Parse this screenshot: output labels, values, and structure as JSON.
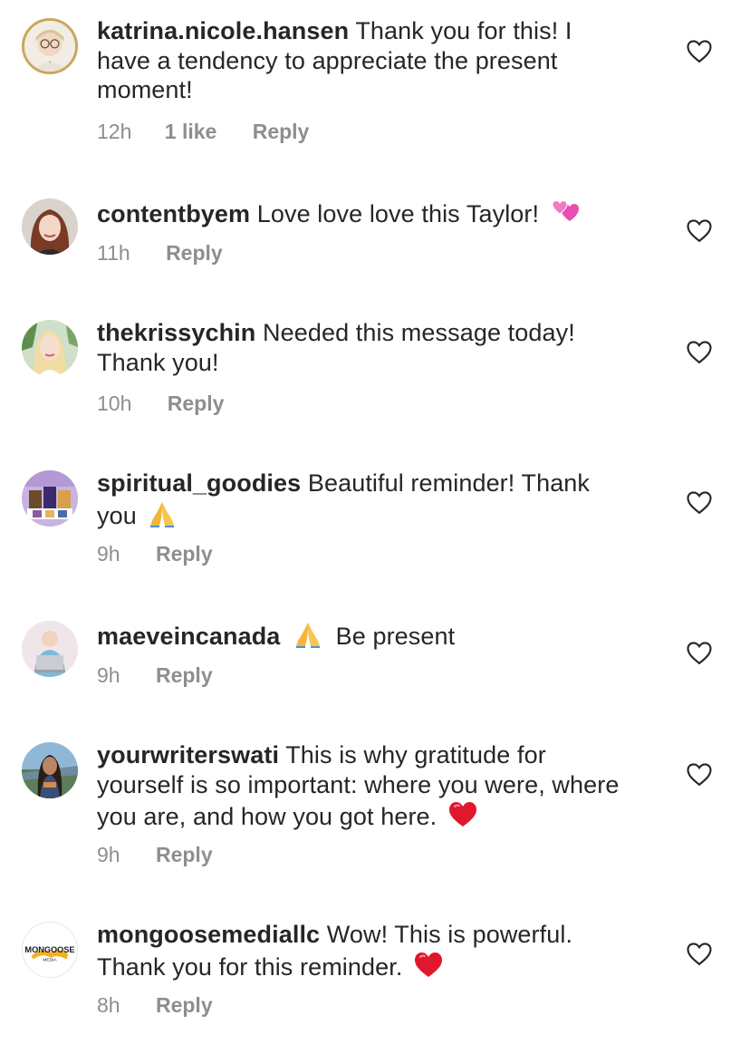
{
  "comments": [
    {
      "username": "katrina.nicole.hansen",
      "text": "Thank you for this! I have a tendency to appreciate the present moment!",
      "time": "12h",
      "likes": "1 like",
      "reply": "Reply",
      "avatar": "avatar-woman-glasses",
      "emoji": ""
    },
    {
      "username": "contentbyem",
      "text": "Love love love this Taylor!",
      "time": "11h",
      "likes": "",
      "reply": "Reply",
      "avatar": "avatar-woman-red-hair",
      "emoji": "two-hearts-emoji"
    },
    {
      "username": "thekrissychin",
      "text": "Needed this message today! Thank you!",
      "time": "10h",
      "likes": "",
      "reply": "Reply",
      "avatar": "avatar-woman-blonde",
      "emoji": ""
    },
    {
      "username": "spiritual_goodies",
      "text": "Beautiful reminder! Thank you",
      "time": "9h",
      "likes": "",
      "reply": "Reply",
      "avatar": "avatar-products",
      "emoji": "folded-hands-emoji"
    },
    {
      "username": "maeveincanada",
      "text": "Be present",
      "time": "9h",
      "likes": "",
      "reply": "Reply",
      "avatar": "avatar-woman-laptop",
      "emoji": "folded-hands-emoji"
    },
    {
      "username": "yourwriterswati",
      "text": "This is why gratitude for yourself is so important: where you were, where you are, and how you got here.",
      "time": "9h",
      "likes": "",
      "reply": "Reply",
      "avatar": "avatar-woman-outdoor",
      "emoji": "red-heart-emoji"
    },
    {
      "username": "mongoosemediallc",
      "text": "Wow! This is powerful. Thank you for this reminder.",
      "time": "8h",
      "likes": "",
      "reply": "Reply",
      "avatar": "avatar-mongoose-logo",
      "logo_text": "MONGOOSE",
      "logo_subtext": "MEDIA",
      "emoji": "red-heart-emoji"
    }
  ],
  "colors": {
    "text": "#262626",
    "meta": "#8e8e8e",
    "heart_outline": "#262626",
    "red_heart": "#e0182d",
    "pink_heart": "#e64fb1",
    "folded_hands": "#f4b63a"
  }
}
